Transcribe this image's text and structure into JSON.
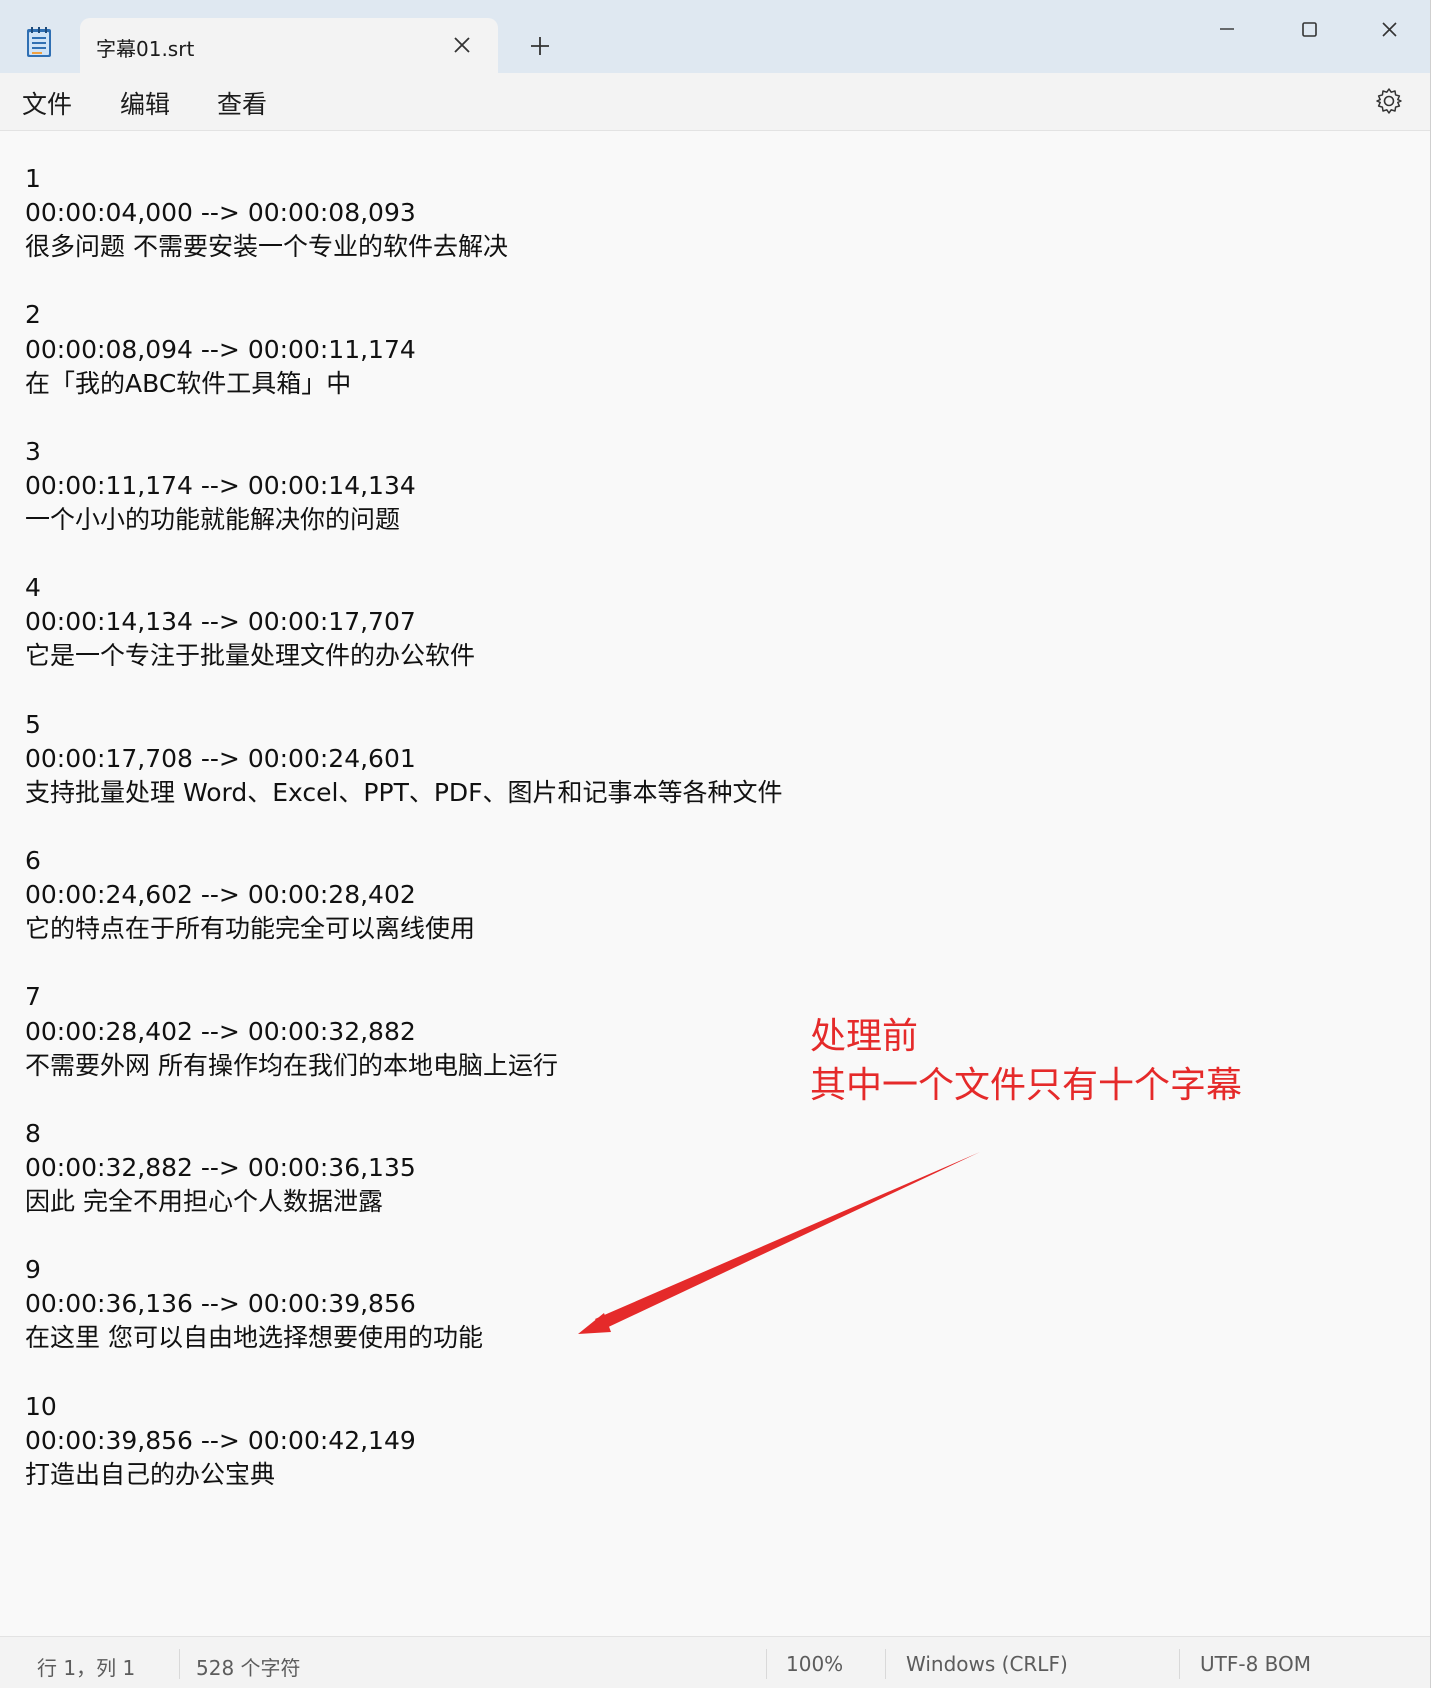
{
  "window": {
    "tab_title": "字幕01.srt",
    "accent": "#dfe8f1"
  },
  "menu": {
    "file": "文件",
    "edit": "编辑",
    "view": "查看"
  },
  "editor": {
    "lines": [
      "1",
      "00:00:04,000 --> 00:00:08,093",
      "很多问题 不需要安装一个专业的软件去解决",
      "2",
      "00:00:08,094 --> 00:00:11,174",
      "在「我的ABC软件工具箱」中",
      "3",
      "00:00:11,174 --> 00:00:14,134",
      "一个小小的功能就能解决你的问题",
      "4",
      "00:00:14,134 --> 00:00:17,707",
      "它是一个专注于批量处理文件的办公软件",
      "5",
      "00:00:17,708 --> 00:00:24,601",
      "支持批量处理 Word、Excel、PPT、PDF、图片和记事本等各种文件",
      "6",
      "00:00:24,602 --> 00:00:28,402",
      "它的特点在于所有功能完全可以离线使用",
      "7",
      "00:00:28,402 --> 00:00:32,882",
      "不需要外网 所有操作均在我们的本地电脑上运行",
      "8",
      "00:00:32,882 --> 00:00:36,135",
      "因此 完全不用担心个人数据泄露",
      "9",
      "00:00:36,136 --> 00:00:39,856",
      "在这里 您可以自由地选择想要使用的功能",
      "10",
      "00:00:39,856 --> 00:00:42,149",
      "打造出自己的办公宝典"
    ]
  },
  "annotation": {
    "line1": "处理前",
    "line2": "其中一个文件只有十个字幕",
    "color": "#e52a2a"
  },
  "status": {
    "position": "行 1，列 1",
    "chars": "528 个字符",
    "zoom": "100%",
    "line_ending": "Windows (CRLF)",
    "encoding": "UTF-8 BOM"
  }
}
